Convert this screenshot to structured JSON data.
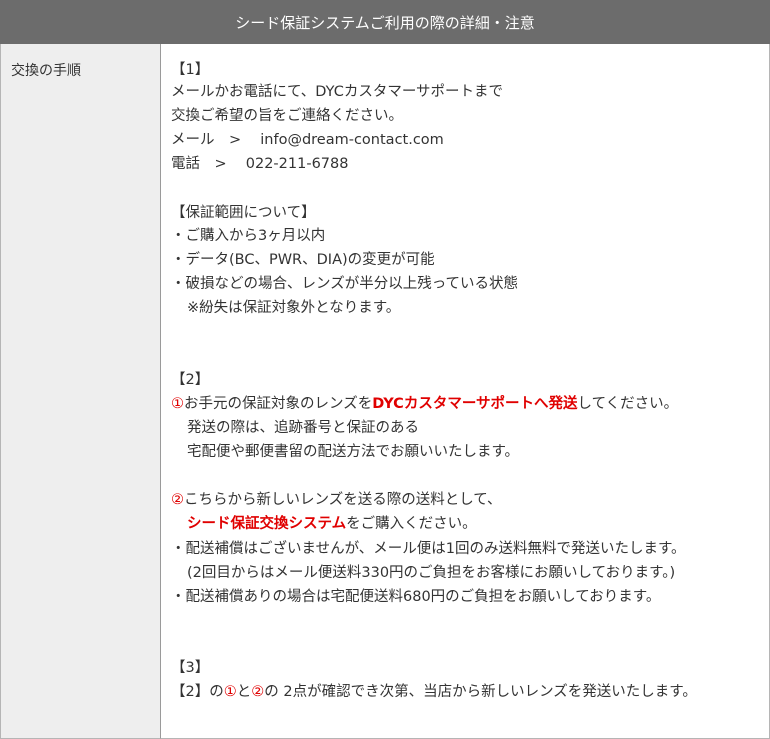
{
  "title": "シード保証システムご利用の際の詳細・注意",
  "row_label": "交換の手順",
  "s1": {
    "heading": "【1】",
    "line1": "メールかお電話にて、DYCカスタマーサポートまで",
    "line2": "交換ご希望の旨をご連絡ください。",
    "mail": "メール　>　 info@dream-contact.com",
    "phone": "電話　>　 022-211-6788"
  },
  "range": {
    "heading": "【保証範囲について】",
    "b1": "・ご購入から3ヶ月以内",
    "b2": "・データ(BC、PWR、DIA)の変更が可能",
    "b3": "・破損などの場合、レンズが半分以上残っている状態",
    "note": "※紛失は保証対象外となります。"
  },
  "s2": {
    "heading": "【2】",
    "p1_mark": "①",
    "p1_text": "お手元の保証対象のレンズを",
    "p1_red": "DYCカスタマーサポートへ発送",
    "p1_end": "してください。",
    "p1_l2": "発送の際は、追跡番号と保証のある",
    "p1_l3": "宅配便や郵便書留の配送方法でお願いいたします。",
    "p2_mark": "②",
    "p2_text": "こちらから新しいレンズを送る際の送料として、",
    "p2_red": "シード保証交換システム",
    "p2_end": "をご購入ください。",
    "b1": "・配送補償はございませんが、メール便は1回のみ送料無料で発送いたします。",
    "b1_sub": "(2回目からはメール便送料330円のご負担をお客様にお願いしております。)",
    "b2": "・配送補償ありの場合は宅配便送料680円のご負担をお願いしております。"
  },
  "s3": {
    "heading": "【3】",
    "t1": "【2】の",
    "m1": "①",
    "t2": "と",
    "m2": "②",
    "t3": "の 2点が確認でき次第、当店から新しいレンズを発送いたします。"
  },
  "colors": {
    "header_bg": "#6c6c6c",
    "label_bg": "#eeeeee",
    "accent_red": "#e00000"
  }
}
